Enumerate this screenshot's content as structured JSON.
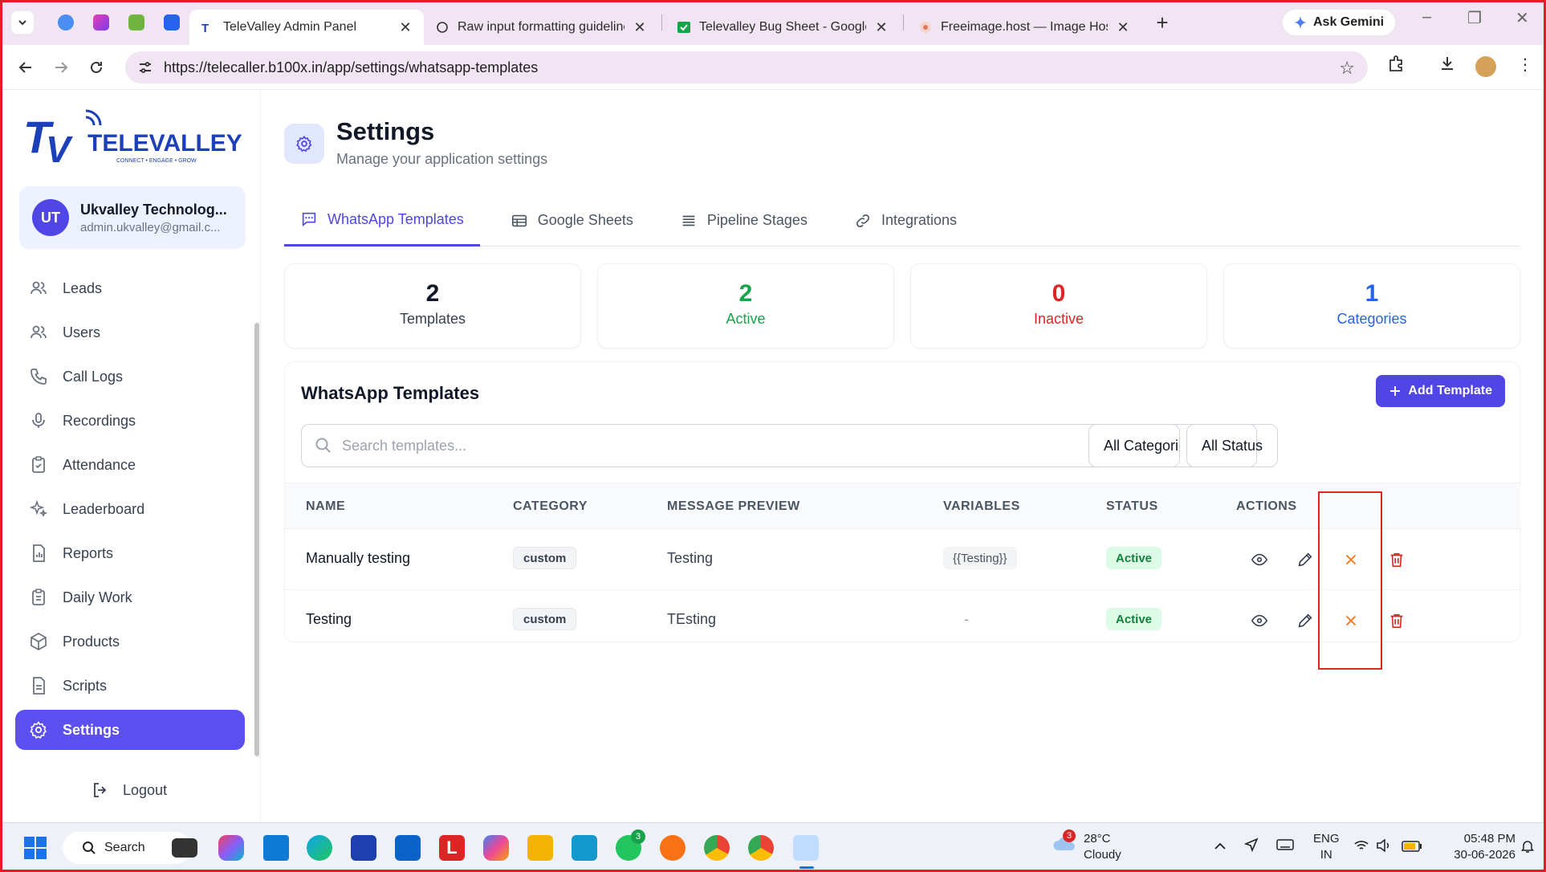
{
  "browser": {
    "tabs": [
      {
        "label": "TeleValley Admin Panel",
        "active": true
      },
      {
        "label": "Raw input formatting guideline",
        "active": false
      },
      {
        "label": "Televalley Bug Sheet - Google S",
        "active": false
      },
      {
        "label": "Freeimage.host — Image Hosti",
        "active": false
      }
    ],
    "new_tab": "+",
    "ask_gemini": "Ask Gemini",
    "url": "https://telecaller.b100x.in/app/settings/whatsapp-templates"
  },
  "sidebar": {
    "logo_text": "TELEVALLEY",
    "logo_tagline": "CONNECT • ENGAGE • GROW",
    "user": {
      "initials": "UT",
      "name": "Ukvalley Technolog...",
      "email": "admin.ukvalley@gmail.c..."
    },
    "items": [
      {
        "label": "Leads",
        "icon": "users-icon"
      },
      {
        "label": "Users",
        "icon": "users-icon"
      },
      {
        "label": "Call Logs",
        "icon": "phone-icon"
      },
      {
        "label": "Recordings",
        "icon": "microphone-icon"
      },
      {
        "label": "Attendance",
        "icon": "clipboard-check-icon"
      },
      {
        "label": "Leaderboard",
        "icon": "sparkle-icon"
      },
      {
        "label": "Reports",
        "icon": "report-icon"
      },
      {
        "label": "Daily Work",
        "icon": "clipboard-list-icon"
      },
      {
        "label": "Products",
        "icon": "cube-icon"
      },
      {
        "label": "Scripts",
        "icon": "document-icon"
      },
      {
        "label": "Settings",
        "icon": "gear-icon",
        "active": true
      }
    ],
    "logout": "Logout"
  },
  "page": {
    "title": "Settings",
    "subtitle": "Manage your application settings",
    "tabs": [
      {
        "label": "WhatsApp Templates",
        "active": true
      },
      {
        "label": "Google Sheets"
      },
      {
        "label": "Pipeline Stages"
      },
      {
        "label": "Integrations"
      }
    ]
  },
  "stats": [
    {
      "value": "2",
      "label": "Templates",
      "color": "#111827"
    },
    {
      "value": "2",
      "label": "Active",
      "color": "#16a34a"
    },
    {
      "value": "0",
      "label": "Inactive",
      "color": "#dc2626"
    },
    {
      "value": "1",
      "label": "Categories",
      "color": "#2563eb"
    }
  ],
  "templates": {
    "title": "WhatsApp Templates",
    "add_button": "Add Template",
    "search_placeholder": "Search templates...",
    "category_filter": "All Categories",
    "status_filter": "All Status",
    "columns": [
      "NAME",
      "CATEGORY",
      "MESSAGE PREVIEW",
      "VARIABLES",
      "STATUS",
      "ACTIONS"
    ],
    "rows": [
      {
        "name": "Manually testing",
        "category": "custom",
        "preview": "Testing",
        "variables": "{{Testing}}",
        "status": "Active"
      },
      {
        "name": "Testing",
        "category": "custom",
        "preview": "TEsting",
        "variables": "-",
        "status": "Active"
      }
    ]
  },
  "taskbar": {
    "search": "Search",
    "weather_temp": "28°C",
    "weather_text": "Cloudy",
    "weather_badge": "3",
    "whatsapp_badge": "3",
    "lang": "ENG",
    "region": "IN",
    "time": "05:48 PM",
    "date": "30-06-2026"
  },
  "colors": {
    "accent": "#4f46e5",
    "active_green": "#16a34a",
    "danger": "#dc2626",
    "orange": "#f97316"
  }
}
